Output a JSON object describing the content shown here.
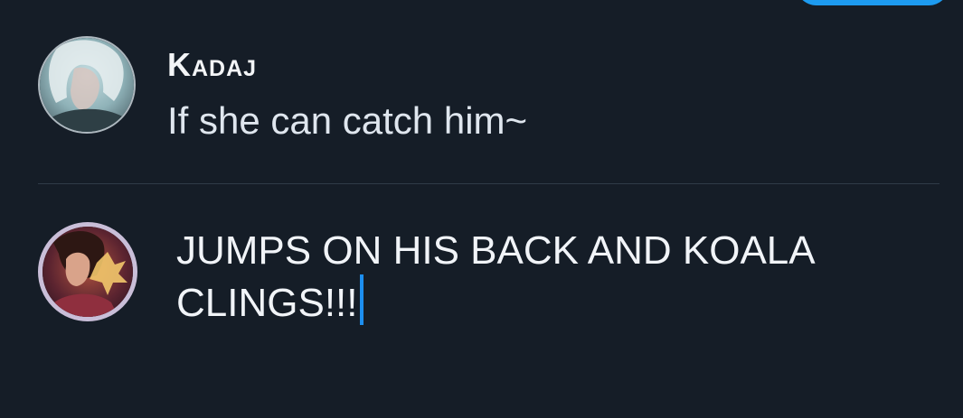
{
  "top_button": {
    "color": "#1d9bf0"
  },
  "reply": {
    "author": "Kadaj",
    "text": "If she can catch him~",
    "avatar_icon": "kadaj-avatar"
  },
  "composer": {
    "text_line1": "JUMPS ON HIS BACK AND KOALA",
    "text_line2": "CLINGS!!!",
    "avatar_icon": "user-avatar",
    "caret_color": "#1d8ff0"
  },
  "colors": {
    "background": "#151d27",
    "divider": "#2f3b47",
    "accent": "#1d9bf0"
  }
}
